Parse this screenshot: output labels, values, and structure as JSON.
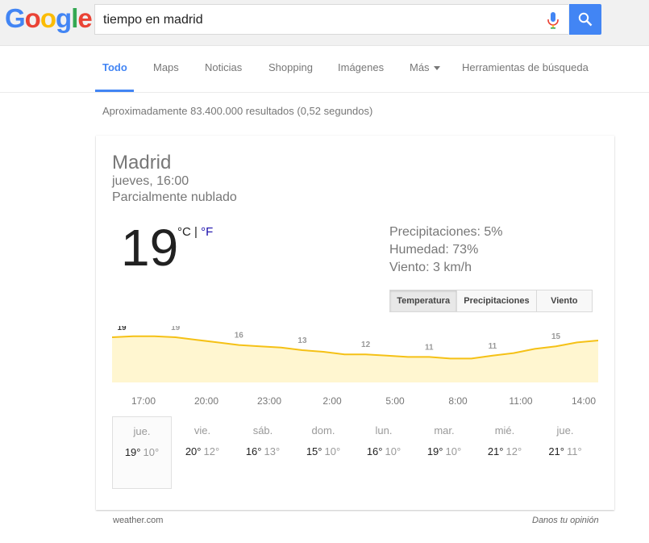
{
  "search": {
    "query": "tiempo en madrid",
    "logo_text": "Google"
  },
  "tabs": [
    {
      "label": "Todo",
      "active": true
    },
    {
      "label": "Maps"
    },
    {
      "label": "Noticias"
    },
    {
      "label": "Shopping"
    },
    {
      "label": "Imágenes"
    },
    {
      "label": "Más"
    },
    {
      "label": "Herramientas de búsqueda"
    }
  ],
  "results_count": "Aproximadamente 83.400.000 resultados (0,52 segundos)",
  "weather": {
    "location": "Madrid",
    "day_time": "jueves, 16:00",
    "condition": "Parcialmente nublado",
    "temperature": "19",
    "unit_c": "°C",
    "unit_sep": " | ",
    "unit_f": "°F",
    "precipitation": "Precipitaciones: 5%",
    "humidity": "Humedad: 73%",
    "wind": "Viento: 3 km/h",
    "toggles": [
      "Temperatura",
      "Precipitaciones",
      "Viento"
    ],
    "selected_toggle": "Temperatura",
    "hour_labels": [
      "17:00",
      "20:00",
      "23:00",
      "2:00",
      "5:00",
      "8:00",
      "11:00",
      "14:00"
    ],
    "days": [
      {
        "name": "jue.",
        "high": "19°",
        "low": "10°",
        "selected": true
      },
      {
        "name": "vie.",
        "high": "20°",
        "low": "12°"
      },
      {
        "name": "sáb.",
        "high": "16°",
        "low": "13°"
      },
      {
        "name": "dom.",
        "high": "15°",
        "low": "10°"
      },
      {
        "name": "lun.",
        "high": "16°",
        "low": "10°"
      },
      {
        "name": "mar.",
        "high": "19°",
        "low": "10°"
      },
      {
        "name": "mié.",
        "high": "21°",
        "low": "12°"
      },
      {
        "name": "jue.",
        "high": "21°",
        "low": "11°"
      }
    ],
    "source": "weather.com",
    "feedback": "Danos tu opinión"
  },
  "colors": {
    "accent": "#4285f4",
    "chart_line": "#f5c116",
    "chart_fill": "#fff6d0"
  },
  "chart_data": {
    "type": "area",
    "x": [
      "16:00",
      "17:00",
      "18:00",
      "19:00",
      "20:00",
      "21:00",
      "22:00",
      "23:00",
      "0:00",
      "1:00",
      "2:00",
      "3:00",
      "4:00",
      "5:00",
      "6:00",
      "7:00",
      "8:00",
      "9:00",
      "10:00",
      "11:00",
      "12:00",
      "13:00",
      "14:00",
      "15:00"
    ],
    "values": [
      19,
      19.3,
      19.3,
      19,
      18.2,
      17.4,
      16.6,
      16.2,
      15.8,
      15,
      14.5,
      13.7,
      13.7,
      13.3,
      12.9,
      12.9,
      12.4,
      12.4,
      13.3,
      14.1,
      15.4,
      16.2,
      17.4,
      18
    ],
    "labels": [
      {
        "x": "16:00",
        "text": "19"
      },
      {
        "x": "19:00",
        "text": "19"
      },
      {
        "x": "22:00",
        "text": "16"
      },
      {
        "x": "1:00",
        "text": "13"
      },
      {
        "x": "4:00",
        "text": "12"
      },
      {
        "x": "7:00",
        "text": "11"
      },
      {
        "x": "10:00",
        "text": "11"
      },
      {
        "x": "13:00",
        "text": "15"
      }
    ]
  }
}
